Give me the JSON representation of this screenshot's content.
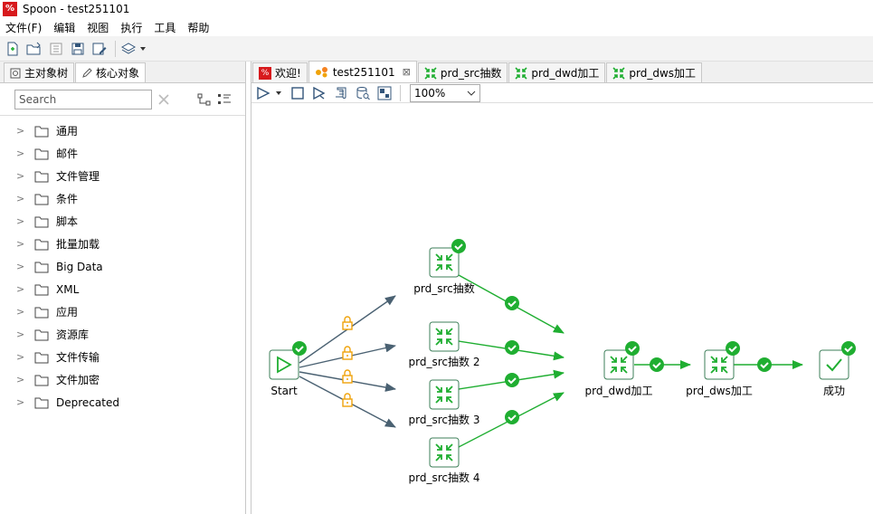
{
  "window": {
    "title": "Spoon - test251101",
    "logo_text": "%"
  },
  "menu": [
    "文件(F)",
    "编辑",
    "视图",
    "执行",
    "工具",
    "帮助"
  ],
  "left_tabs": [
    {
      "label": "主对象树"
    },
    {
      "label": "核心对象"
    }
  ],
  "search": {
    "placeholder": "Search",
    "value": ""
  },
  "tree": [
    "通用",
    "邮件",
    "文件管理",
    "条件",
    "脚本",
    "批量加载",
    "Big Data",
    "XML",
    "应用",
    "资源库",
    "文件传输",
    "文件加密",
    "Deprecated"
  ],
  "tabs": [
    {
      "label": "欢迎!",
      "icon": "spoon-icon"
    },
    {
      "label": "test251101",
      "icon": "job-icon",
      "active": true
    },
    {
      "label": "prd_src抽数",
      "icon": "transformation-icon"
    },
    {
      "label": "prd_dwd加工",
      "icon": "transformation-icon"
    },
    {
      "label": "prd_dws加工",
      "icon": "transformation-icon"
    }
  ],
  "zoom": "100%",
  "colors": {
    "green": "#1fae31",
    "slate": "#4a6172",
    "lock": "#f0a30a",
    "node_border": "#3d7f59"
  },
  "nodes": {
    "start": "Start",
    "src1": "prd_src抽数",
    "src2": "prd_src抽数 2",
    "src3": "prd_src抽数 3",
    "src4": "prd_src抽数 4",
    "dwd": "prd_dwd加工",
    "dws": "prd_dws加工",
    "success": "成功"
  }
}
